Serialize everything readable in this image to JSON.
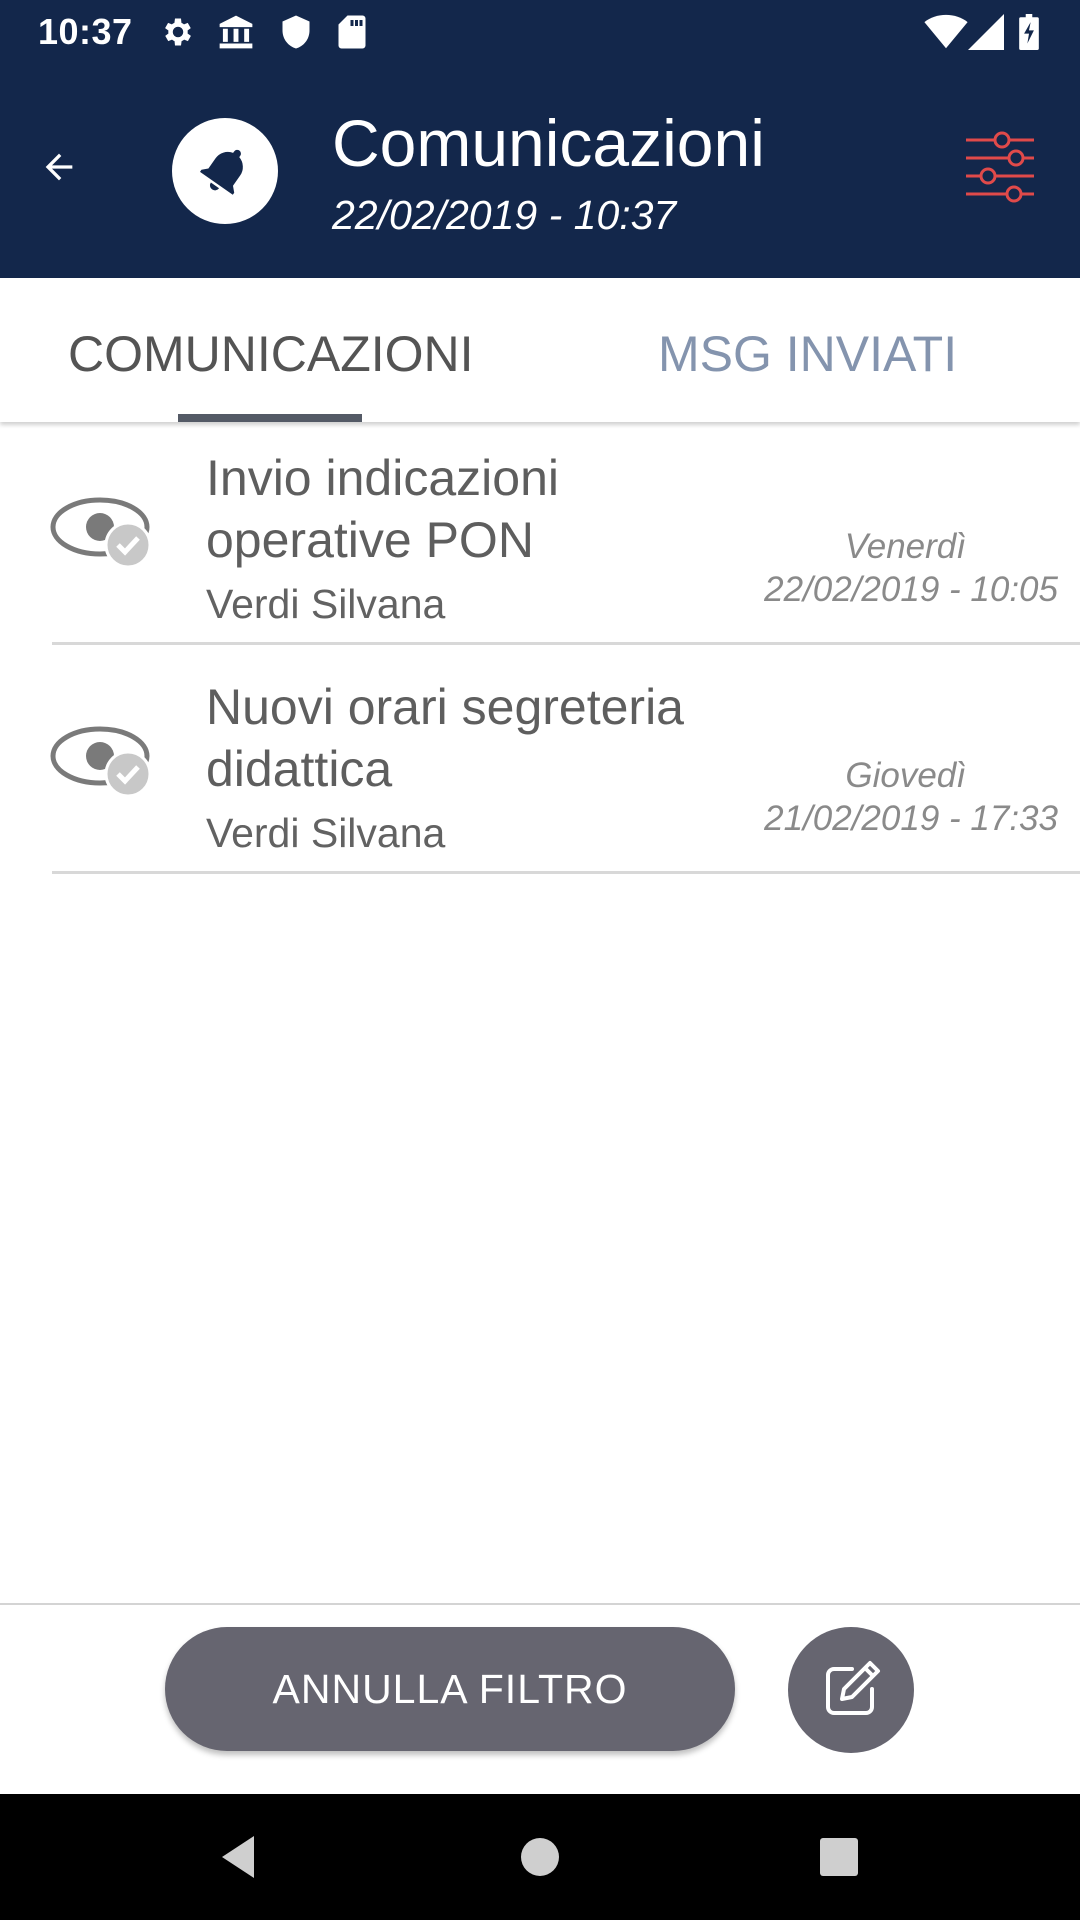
{
  "status_bar": {
    "time": "10:37",
    "icons": [
      "gear-icon",
      "bank-icon",
      "shield-icon",
      "sd-card-icon",
      "wifi-icon",
      "signal-icon",
      "battery-charging-icon"
    ]
  },
  "header": {
    "title": "Comunicazioni",
    "subtitle": "22/02/2019 - 10:37",
    "icons": [
      "back-arrow-icon",
      "bell-icon",
      "filter-sliders-icon"
    ],
    "colors": {
      "background": "#13274b",
      "filter_icon": "#e04a4a"
    }
  },
  "tabs": [
    {
      "label": "COMUNICAZIONI",
      "selected": true
    },
    {
      "label": "MSG INVIATI",
      "selected": false
    }
  ],
  "messages": [
    {
      "title": "Invio indicazioni operative PON",
      "sender": "Verdi Silvana",
      "day": "Venerdì",
      "datetime": "22/02/2019 - 10:05",
      "read": true
    },
    {
      "title": "Nuovi orari segreteria didattica",
      "sender": "Verdi Silvana",
      "day": "Giovedì",
      "datetime": "21/02/2019 - 17:33",
      "read": true
    }
  ],
  "actions": {
    "clear_filter_label": "ANNULLA FILTRO",
    "compose_icon": "compose-icon"
  },
  "system_nav": [
    "nav-back-icon",
    "nav-home-icon",
    "nav-recents-icon"
  ]
}
